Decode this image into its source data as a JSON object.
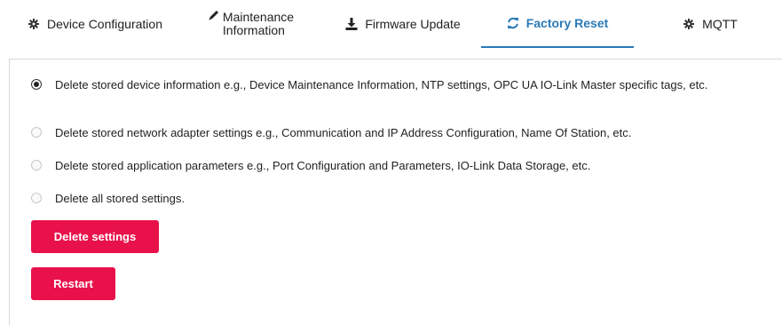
{
  "tabs": {
    "device_configuration": {
      "label": "Device Configuration",
      "icon": "gear-icon"
    },
    "maintenance_information": {
      "label_line1": "Maintenance",
      "label_line2": "Information",
      "icon": "pencil-icon"
    },
    "firmware_update": {
      "label": "Firmware Update",
      "icon": "download-icon"
    },
    "factory_reset": {
      "label": "Factory Reset",
      "icon": "refresh-icon",
      "active": true
    },
    "mqtt": {
      "label": "MQTT",
      "icon": "gear-icon"
    }
  },
  "colors": {
    "accent": "#2a7ab7",
    "danger_button": "#e8114a"
  },
  "options": [
    {
      "label": "Delete stored device information e.g., Device Maintenance Information, NTP settings, OPC UA IO-Link Master specific tags, etc.",
      "checked": true
    },
    {
      "label": "Delete stored network adapter settings e.g., Communication and IP Address Configuration, Name Of Station, etc.",
      "checked": false
    },
    {
      "label": "Delete stored application parameters e.g., Port Configuration and Parameters, IO-Link Data Storage, etc.",
      "checked": false
    },
    {
      "label": "Delete all stored settings.",
      "checked": false
    }
  ],
  "buttons": {
    "delete_settings": "Delete settings",
    "restart": "Restart"
  }
}
